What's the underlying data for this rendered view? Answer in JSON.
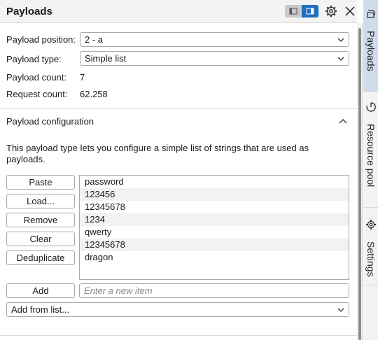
{
  "header": {
    "title": "Payloads"
  },
  "payload_position": {
    "label": "Payload position:",
    "value": "2 - a"
  },
  "payload_type": {
    "label": "Payload type:",
    "value": "Simple list"
  },
  "payload_count": {
    "label": "Payload count:",
    "value": "7"
  },
  "request_count": {
    "label": "Request count:",
    "value": "62.258"
  },
  "config": {
    "title": "Payload configuration",
    "description": "This payload type lets you configure a simple list of strings that are used as payloads."
  },
  "buttons": {
    "paste": "Paste",
    "load": "Load...",
    "remove": "Remove",
    "clear": "Clear",
    "deduplicate": "Deduplicate",
    "add": "Add"
  },
  "list_items": [
    "password",
    "123456",
    "12345678",
    "1234",
    "qwerty",
    "12345678",
    "dragon"
  ],
  "new_item": {
    "placeholder": "Enter a new item",
    "value": ""
  },
  "add_from_list": {
    "value": "Add from list..."
  },
  "sidebar": {
    "tabs": [
      {
        "label": "Payloads",
        "icon": "payloads-icon",
        "active": true
      },
      {
        "label": "Resource pool",
        "icon": "resource-pool-icon",
        "active": false
      },
      {
        "label": "Settings",
        "icon": "gear-icon",
        "active": false
      }
    ]
  },
  "colors": {
    "accent": "#1f6fbf",
    "active_tab": "#cfdcec"
  }
}
